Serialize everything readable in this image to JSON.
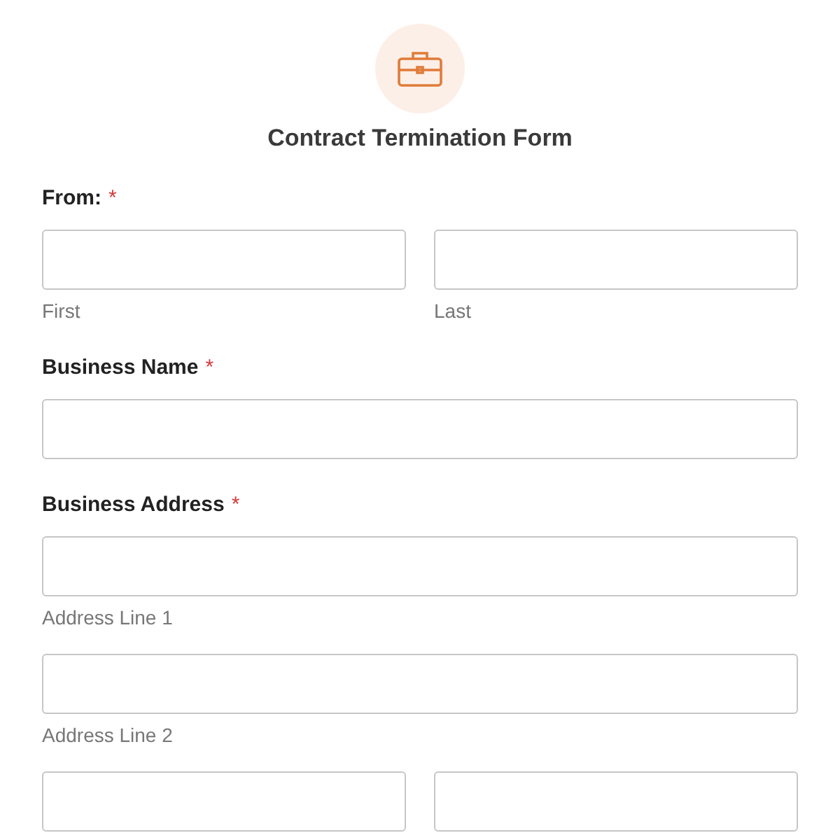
{
  "header": {
    "title": "Contract Termination Form"
  },
  "fields": [
    {
      "label": "From:",
      "required_mark": "*",
      "rows": [
        {
          "inputs": [
            {
              "kind": "text",
              "sublabel": "First"
            },
            {
              "kind": "text",
              "sublabel": "Last"
            }
          ]
        }
      ]
    },
    {
      "label": "Business Name",
      "required_mark": "*",
      "rows": [
        {
          "inputs": [
            {
              "kind": "text"
            }
          ]
        }
      ]
    },
    {
      "label": "Business Address",
      "required_mark": "*",
      "rows": [
        {
          "inputs": [
            {
              "kind": "text",
              "sublabel": "Address Line 1"
            }
          ]
        },
        {
          "inputs": [
            {
              "kind": "text",
              "sublabel": "Address Line 2"
            }
          ]
        },
        {
          "inputs": [
            {
              "kind": "text"
            },
            {
              "kind": "text"
            }
          ]
        }
      ]
    }
  ]
}
